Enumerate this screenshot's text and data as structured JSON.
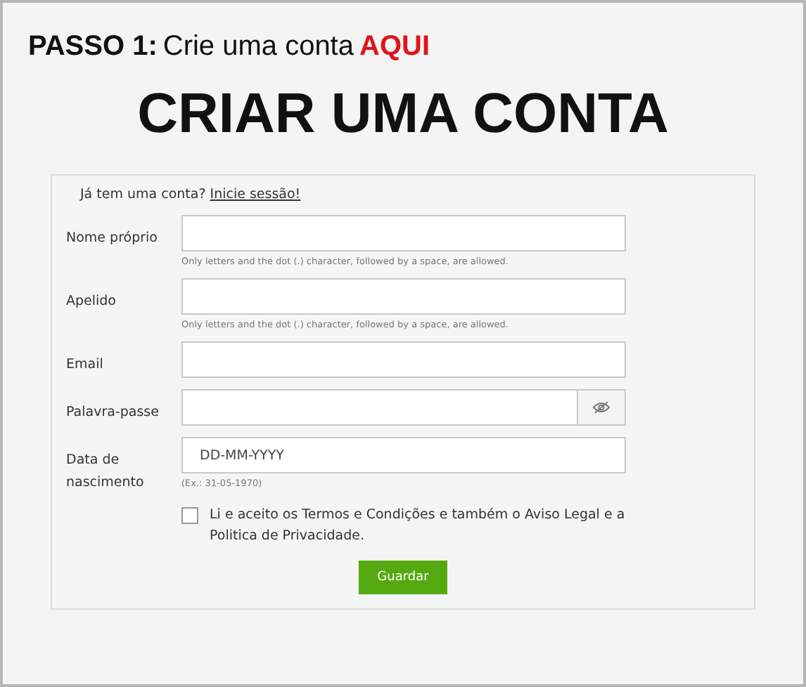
{
  "step": {
    "label": "PASSO 1:",
    "text": "Crie uma conta",
    "link": "AQUI"
  },
  "title": "CRIAR UMA CONTA",
  "login_prompt": {
    "text": "Já tem uma conta?",
    "link": "Inicie sessão!"
  },
  "fields": [
    {
      "kind": "text",
      "label": "Nome próprio",
      "help": "Only letters and the dot (.) character, followed by a space, are allowed."
    },
    {
      "kind": "text",
      "label": "Apelido",
      "help": "Only letters and the dot (.) character, followed by a space, are allowed."
    },
    {
      "kind": "text",
      "label": "Email"
    },
    {
      "kind": "password",
      "label": "Palavra-passe"
    },
    {
      "kind": "date",
      "label": "Data de nascimento",
      "placeholder": "DD-MM-YYYY",
      "help": "(Ex.: 31-05-1970)"
    }
  ],
  "terms": {
    "text": "Li e aceito os Termos e Condições e também o Aviso Legal e a Politica de Privacidade.",
    "checked": false
  },
  "submit": "Guardar"
}
